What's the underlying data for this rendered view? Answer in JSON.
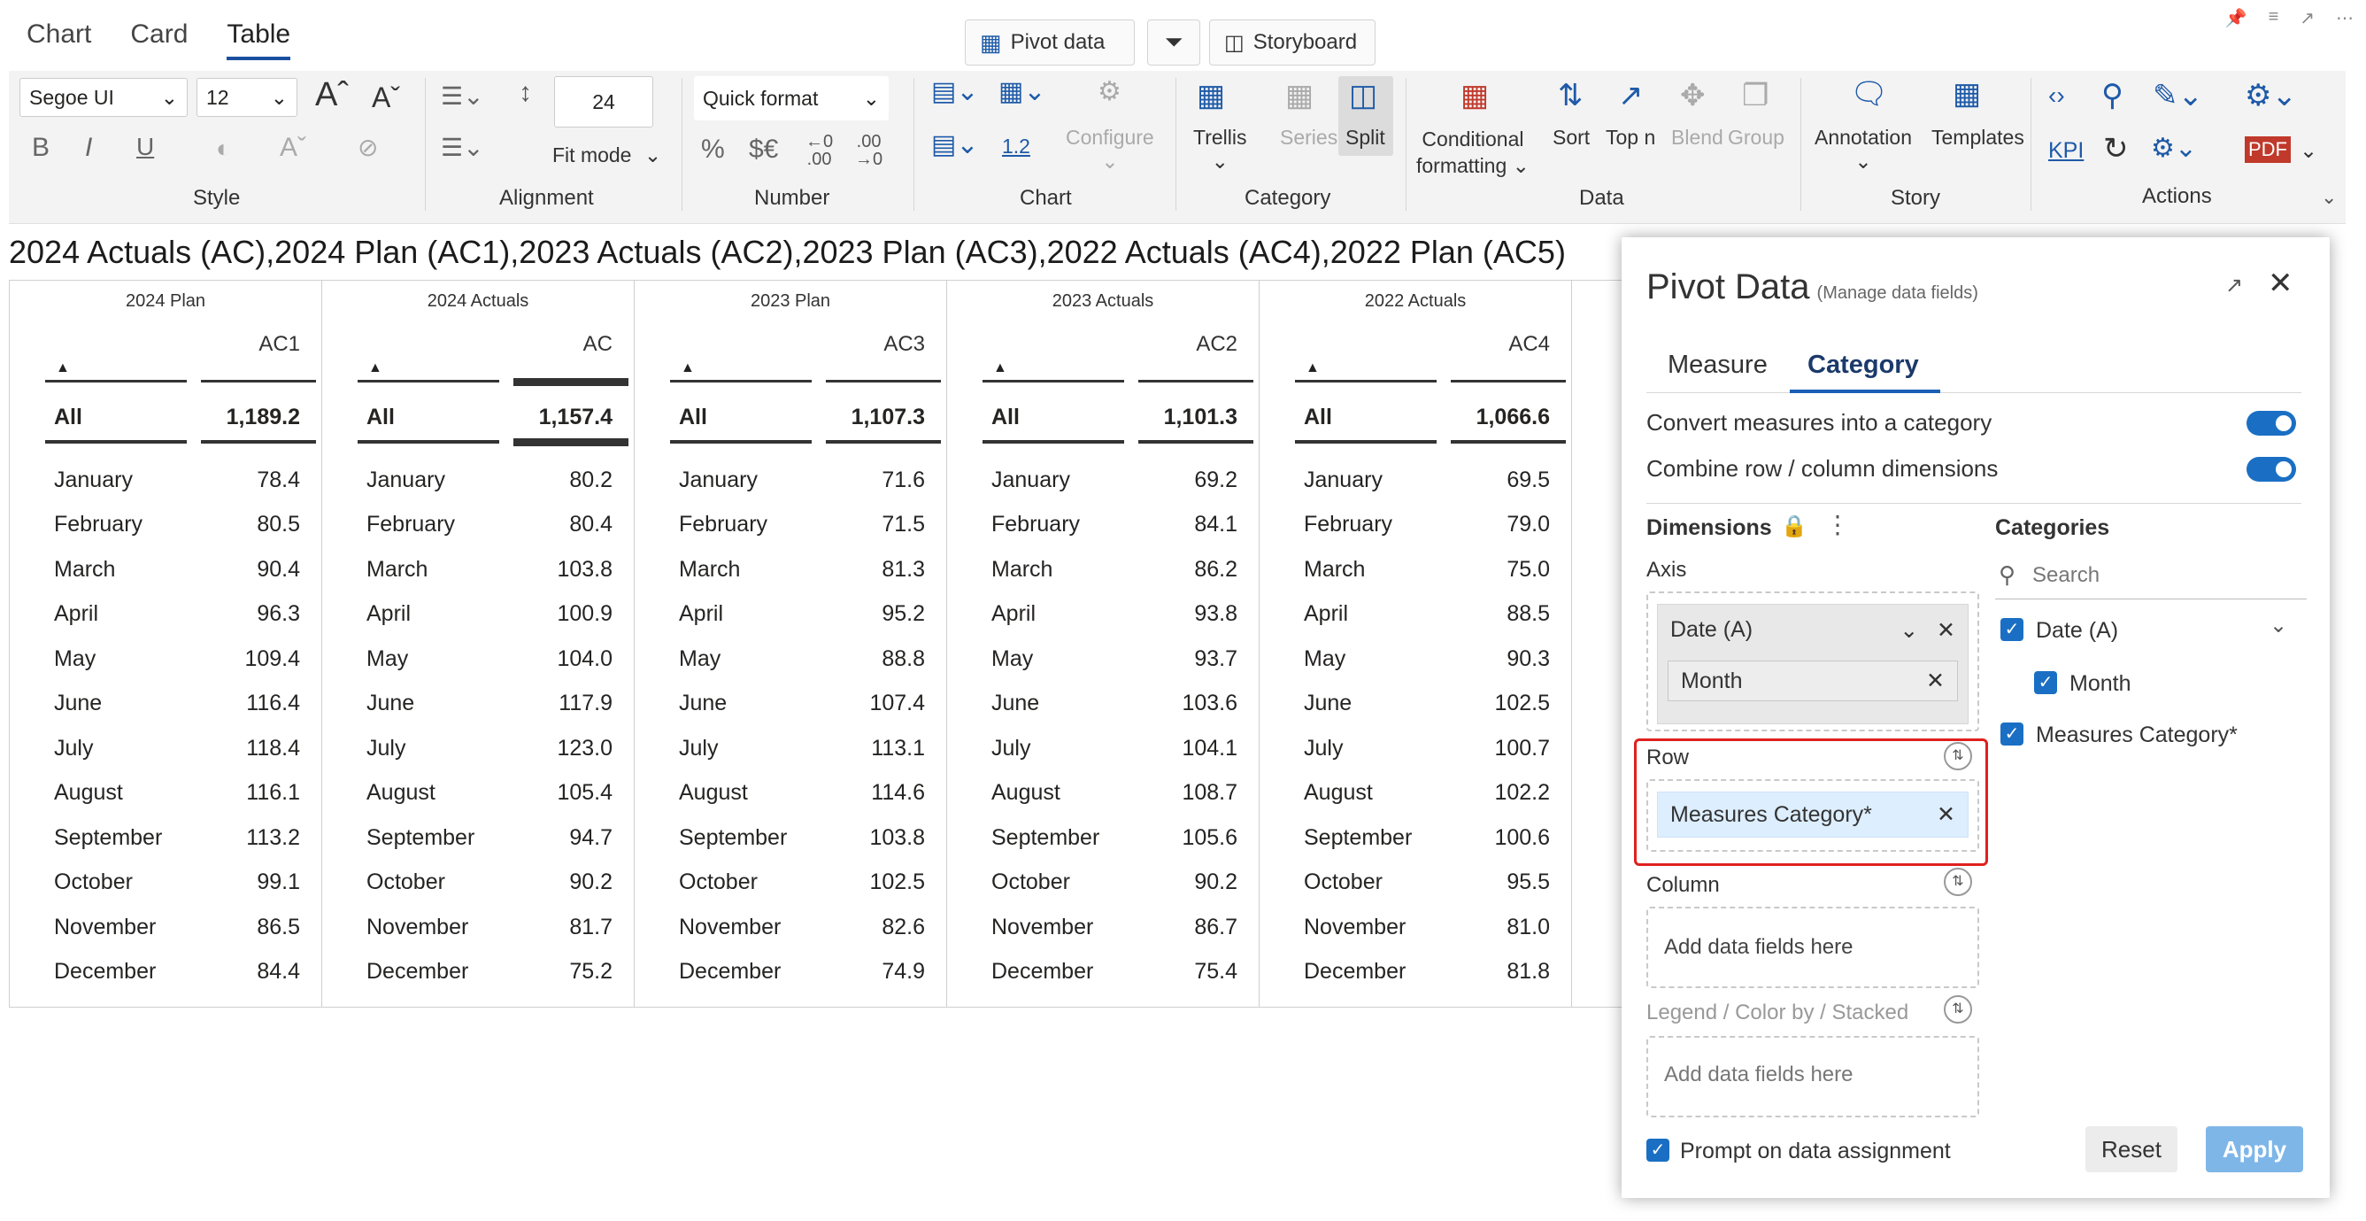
{
  "tabs": [
    "Chart",
    "Card",
    "Table"
  ],
  "toolbar_top": {
    "pivot": "Pivot  data",
    "storyboard": "Storyboard"
  },
  "ribbon": {
    "font_family": "Segoe UI",
    "font_size": "12",
    "line_height": "24",
    "fit_mode": "Fit mode",
    "quick_format": "Quick format",
    "chart_value": "1.2",
    "configure": "Configure",
    "trellis": "Trellis",
    "series": "Series",
    "split": "Split",
    "cond_fmt_1": "Conditional",
    "cond_fmt_2": "formatting",
    "sort": "Sort",
    "topn": "Top n",
    "blend": "Blend",
    "group": "Group",
    "annotation": "Annotation",
    "templates": "Templates",
    "kpi": "KPI",
    "groups": [
      "Style",
      "Alignment",
      "Number",
      "Chart",
      "Category",
      "Data",
      "Story",
      "Actions"
    ]
  },
  "heading": "2024 Actuals (AC),2024 Plan (AC1),2023 Actuals (AC2),2023 Plan (AC3),2022 Actuals (AC4),2022 Plan (AC5)",
  "table": {
    "columns": [
      {
        "title": "2024 Plan",
        "code": "AC1",
        "all_label": "All",
        "all": "1,189.2",
        "rows": [
          [
            "January",
            "78.4"
          ],
          [
            "February",
            "80.5"
          ],
          [
            "March",
            "90.4"
          ],
          [
            "April",
            "96.3"
          ],
          [
            "May",
            "109.4"
          ],
          [
            "June",
            "116.4"
          ],
          [
            "July",
            "118.4"
          ],
          [
            "August",
            "116.1"
          ],
          [
            "September",
            "113.2"
          ],
          [
            "October",
            "99.1"
          ],
          [
            "November",
            "86.5"
          ],
          [
            "December",
            "84.4"
          ]
        ]
      },
      {
        "title": "2024 Actuals",
        "code": "AC",
        "all_label": "All",
        "all": "1,157.4",
        "rows": [
          [
            "January",
            "80.2"
          ],
          [
            "February",
            "80.4"
          ],
          [
            "March",
            "103.8"
          ],
          [
            "April",
            "100.9"
          ],
          [
            "May",
            "104.0"
          ],
          [
            "June",
            "117.9"
          ],
          [
            "July",
            "123.0"
          ],
          [
            "August",
            "105.4"
          ],
          [
            "September",
            "94.7"
          ],
          [
            "October",
            "90.2"
          ],
          [
            "November",
            "81.7"
          ],
          [
            "December",
            "75.2"
          ]
        ]
      },
      {
        "title": "2023 Plan",
        "code": "AC3",
        "all_label": "All",
        "all": "1,107.3",
        "rows": [
          [
            "January",
            "71.6"
          ],
          [
            "February",
            "71.5"
          ],
          [
            "March",
            "81.3"
          ],
          [
            "April",
            "95.2"
          ],
          [
            "May",
            "88.8"
          ],
          [
            "June",
            "107.4"
          ],
          [
            "July",
            "113.1"
          ],
          [
            "August",
            "114.6"
          ],
          [
            "September",
            "103.8"
          ],
          [
            "October",
            "102.5"
          ],
          [
            "November",
            "82.6"
          ],
          [
            "December",
            "74.9"
          ]
        ]
      },
      {
        "title": "2023 Actuals",
        "code": "AC2",
        "all_label": "All",
        "all": "1,101.3",
        "rows": [
          [
            "January",
            "69.2"
          ],
          [
            "February",
            "84.1"
          ],
          [
            "March",
            "86.2"
          ],
          [
            "April",
            "93.8"
          ],
          [
            "May",
            "93.7"
          ],
          [
            "June",
            "103.6"
          ],
          [
            "July",
            "104.1"
          ],
          [
            "August",
            "108.7"
          ],
          [
            "September",
            "105.6"
          ],
          [
            "October",
            "90.2"
          ],
          [
            "November",
            "86.7"
          ],
          [
            "December",
            "75.4"
          ]
        ]
      },
      {
        "title": "2022 Actuals",
        "code": "AC4",
        "all_label": "All",
        "all": "1,066.6",
        "rows": [
          [
            "January",
            "69.5"
          ],
          [
            "February",
            "79.0"
          ],
          [
            "March",
            "75.0"
          ],
          [
            "April",
            "88.5"
          ],
          [
            "May",
            "90.3"
          ],
          [
            "June",
            "102.5"
          ],
          [
            "July",
            "100.7"
          ],
          [
            "August",
            "102.2"
          ],
          [
            "September",
            "100.6"
          ],
          [
            "October",
            "95.5"
          ],
          [
            "November",
            "81.0"
          ],
          [
            "December",
            "81.8"
          ]
        ]
      }
    ]
  },
  "pivot": {
    "title": "Pivot Data",
    "subtitle": "(Manage data fields)",
    "tab_measure": "Measure",
    "tab_category": "Category",
    "opt_convert": "Convert measures into a category",
    "opt_combine": "Combine row / column dimensions",
    "dimensions": "Dimensions",
    "axis": "Axis",
    "axis_chip1": "Date (A)",
    "axis_chip2": "Month",
    "row": "Row",
    "row_chip": "Measures Category*",
    "column": "Column",
    "column_placeholder": "Add data fields here",
    "legend": "Legend / Color by / Stacked",
    "legend_placeholder": "Add data fields here",
    "categories": "Categories",
    "search_placeholder": "Search",
    "cat_date": "Date (A)",
    "cat_month": "Month",
    "cat_measures": "Measures Category*",
    "prompt": "Prompt on data assignment",
    "reset": "Reset",
    "apply": "Apply"
  },
  "colors": {
    "accent": "#1a6fc4",
    "highlight": "#e0201f",
    "apply_bg": "#7fb6e8"
  }
}
